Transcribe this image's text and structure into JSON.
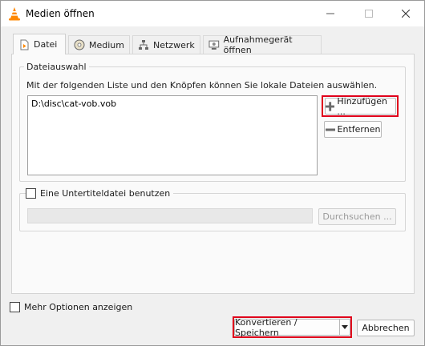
{
  "window": {
    "title": "Medien öffnen",
    "brand_color": "#ff8800"
  },
  "tabs": [
    {
      "label": "Datei",
      "icon": "file-icon",
      "active": true
    },
    {
      "label": "Medium",
      "icon": "disc-icon",
      "active": false
    },
    {
      "label": "Netzwerk",
      "icon": "network-icon",
      "active": false
    },
    {
      "label": "Aufnahmegerät öffnen",
      "icon": "capture-device-icon",
      "active": false
    }
  ],
  "file_selection": {
    "legend": "Dateiauswahl",
    "hint": "Mit der folgenden Liste und den Knöpfen können Sie lokale Dateien auswählen.",
    "files": [
      "D:\\disc\\cat-vob.vob"
    ],
    "add_label": "Hinzufügen ...",
    "remove_label": "Entfernen"
  },
  "subtitles": {
    "checkbox_label": "Eine Untertiteldatei benutzen",
    "checked": false,
    "path_value": "",
    "browse_label": "Durchsuchen ..."
  },
  "more_options": {
    "label": "Mehr Optionen anzeigen",
    "checked": false
  },
  "footer": {
    "convert_label": "Konvertieren / Speichern",
    "cancel_label": "Abbrechen"
  },
  "highlight_color": "#e0001b"
}
